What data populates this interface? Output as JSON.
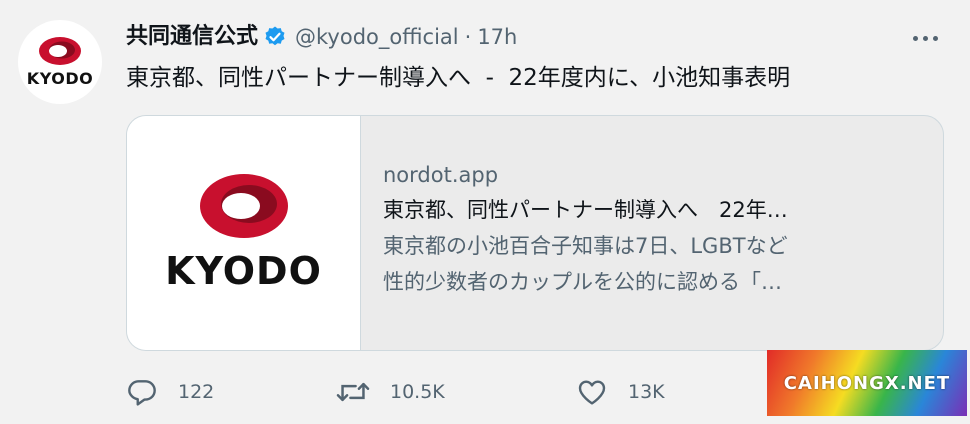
{
  "account": {
    "display_name": "共同通信公式",
    "handle": "@kyodo_official",
    "separator": "·",
    "time": "17h",
    "avatar_text": "KYODO",
    "verified_color": "#1d9bf0"
  },
  "tweet": {
    "text": "東京都、同性パートナー制導入へ  -  22年度内に、小池知事表明"
  },
  "card": {
    "thumb_text": "KYODO",
    "domain": "nordot.app",
    "title": "東京都、同性パートナー制導入へ　22年…",
    "desc_line1": "東京都の小池百合子知事は7日、LGBTなど",
    "desc_line2": "性的少数者のカップルを公的に認める「…"
  },
  "actions": {
    "reply_count": "122",
    "retweet_count": "10.5K",
    "like_count": "13K"
  },
  "icons": {
    "reply": "reply-icon",
    "retweet": "retweet-icon",
    "like": "heart-icon",
    "more": "more-dots-icon",
    "verified": "verified-badge-icon"
  },
  "colors": {
    "logo_red": "#c8102e",
    "muted": "#536471",
    "text": "#0f1419"
  },
  "watermark": {
    "text": "CAIHONGX.NET"
  }
}
